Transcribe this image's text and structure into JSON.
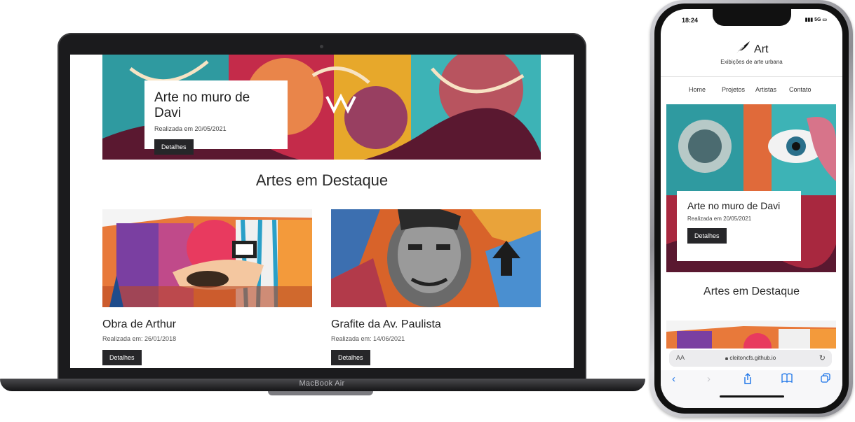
{
  "laptop": {
    "brand_label": "MacBook Air",
    "hero": {
      "title": "Arte no muro de Davi",
      "date": "Realizada em 20/05/2021",
      "button": "Detalhes"
    },
    "section_title": "Artes em Destaque",
    "cards": [
      {
        "title": "Obra de Arthur",
        "date": "Realizada em: 26/01/2018",
        "button": "Detalhes"
      },
      {
        "title": "Grafite da Av. Paulista",
        "date": "Realizada em: 14/06/2021",
        "button": "Detalhes"
      }
    ]
  },
  "phone": {
    "status": {
      "time": "18:24",
      "signal": "5G"
    },
    "brand": {
      "title": "Art",
      "subtitle": "Exibições de arte urbana"
    },
    "nav": [
      "Home",
      "Projetos",
      "Artistas",
      "Contato"
    ],
    "hero": {
      "title": "Arte no muro de Davi",
      "date": "Realizada em 20/05/2021",
      "button": "Detalhes"
    },
    "section_title": "Artes em Destaque",
    "browser": {
      "text_size": "AA",
      "url": "cleitoncfs.github.io"
    }
  },
  "icons": [
    "camera-icon",
    "feather-icon",
    "lock-icon",
    "reload-icon",
    "back-icon",
    "forward-icon",
    "share-icon",
    "bookmarks-icon",
    "tabs-icon",
    "signal-icon",
    "battery-icon"
  ],
  "colors": {
    "button_bg": "#262629",
    "accent_blue": "#1a73e8"
  }
}
